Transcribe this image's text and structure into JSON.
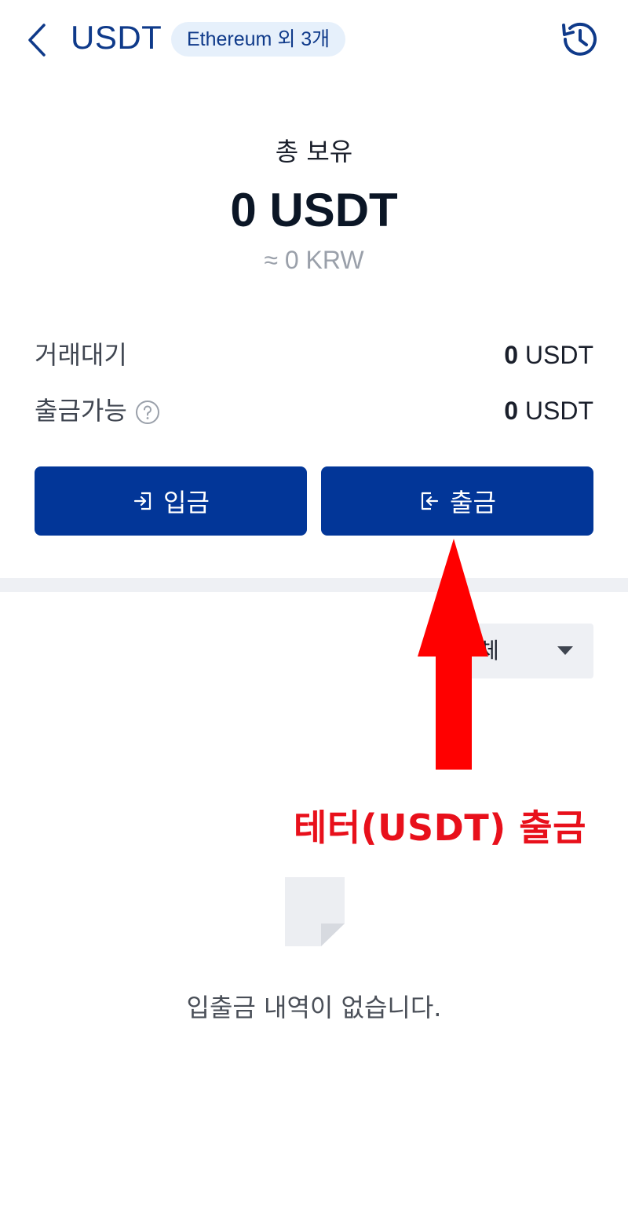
{
  "header": {
    "title": "USDT",
    "network_badge": "Ethereum 외 3개"
  },
  "balance": {
    "label": "총 보유",
    "amount": "0 USDT",
    "krw_equivalent": "≈ 0 KRW"
  },
  "details": [
    {
      "label": "거래대기",
      "value_number": "0",
      "value_unit": "USDT"
    },
    {
      "label": "출금가능",
      "value_number": "0",
      "value_unit": "USDT"
    }
  ],
  "actions": {
    "deposit_label": "입금",
    "withdraw_label": "출금"
  },
  "filter": {
    "selected": "체"
  },
  "annotation": {
    "text": "테터(USDT) 출금",
    "color": "#e8101b"
  },
  "empty_state": {
    "message": "입출금 내역이 없습니다."
  },
  "colors": {
    "primary": "#023698",
    "title": "#0f3a8a",
    "badge_bg": "#e6f0fb",
    "arrow": "#ff0000"
  }
}
